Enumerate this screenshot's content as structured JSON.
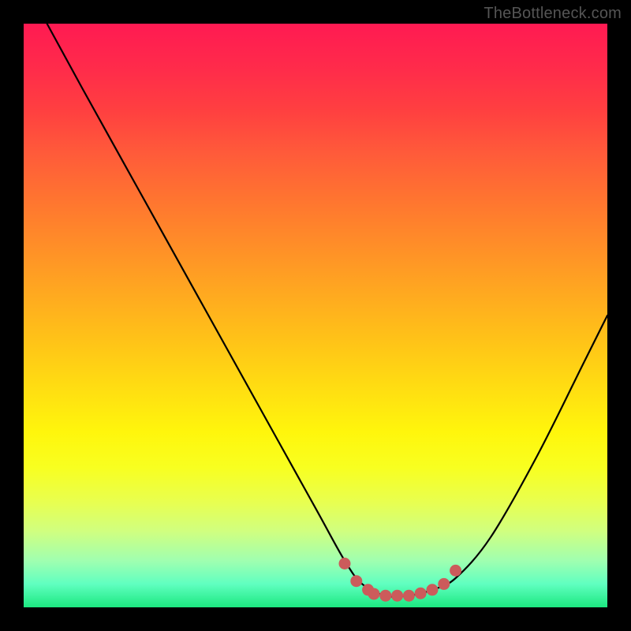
{
  "watermark": "TheBottleneck.com",
  "chart_data": {
    "type": "line",
    "title": "",
    "xlabel": "",
    "ylabel": "",
    "xlim": [
      0,
      100
    ],
    "ylim": [
      0,
      100
    ],
    "series": [
      {
        "name": "bottleneck-curve",
        "x": [
          4,
          10,
          20,
          30,
          40,
          50,
          55,
          58,
          62,
          66,
          70,
          74,
          80,
          88,
          96,
          100
        ],
        "y": [
          100,
          89,
          71,
          53,
          35,
          17,
          8,
          4,
          2,
          2,
          3,
          5,
          12,
          26,
          42,
          50
        ]
      }
    ],
    "markers": {
      "name": "bottleneck-flat-region",
      "color": "#cc5b5b",
      "x": [
        55,
        57,
        59,
        60,
        62,
        64,
        66,
        68,
        70,
        72,
        74
      ],
      "y": [
        7.5,
        4.5,
        3.0,
        2.3,
        2.0,
        2.0,
        2.0,
        2.4,
        3.0,
        4.0,
        6.3
      ]
    }
  }
}
